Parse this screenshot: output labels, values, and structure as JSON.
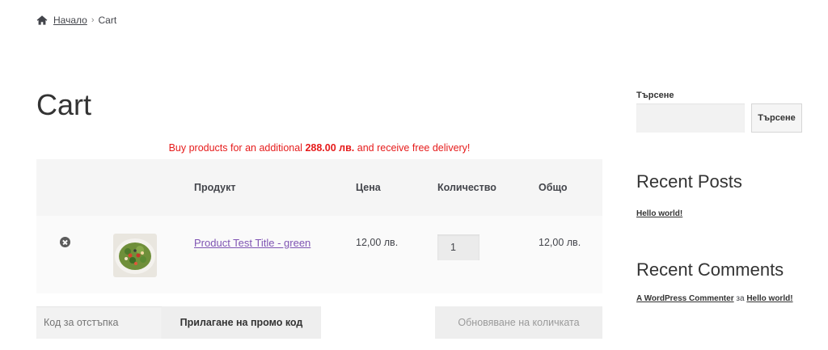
{
  "breadcrumb": {
    "home_label": "Начало",
    "separator": "›",
    "current": "Cart"
  },
  "page": {
    "title": "Cart"
  },
  "notice": {
    "prefix": "Buy products for an additional",
    "amount": "288.00 лв.",
    "suffix": "and receive free delivery!"
  },
  "cart": {
    "headers": {
      "product": "Продукт",
      "price": "Цена",
      "quantity": "Количество",
      "subtotal": "Общо"
    },
    "items": [
      {
        "name": "Product Test Title - green",
        "price": "12,00 лв.",
        "quantity": "1",
        "subtotal": "12,00 лв."
      }
    ]
  },
  "actions": {
    "coupon_placeholder": "Код за отстъпка",
    "apply_coupon": "Прилагане на промо код",
    "update_cart": "Обновяване на количката"
  },
  "sidebar": {
    "search_label": "Търсене",
    "search_button": "Търсене",
    "recent_posts_title": "Recent Posts",
    "recent_posts": [
      "Hello world!"
    ],
    "recent_comments_title": "Recent Comments",
    "recent_comment": {
      "author": "A WordPress Commenter",
      "connector": "за",
      "post": "Hello world!"
    }
  },
  "colors": {
    "link": "#7f54b3",
    "notice": "#e61b1b",
    "text": "#43454b"
  }
}
